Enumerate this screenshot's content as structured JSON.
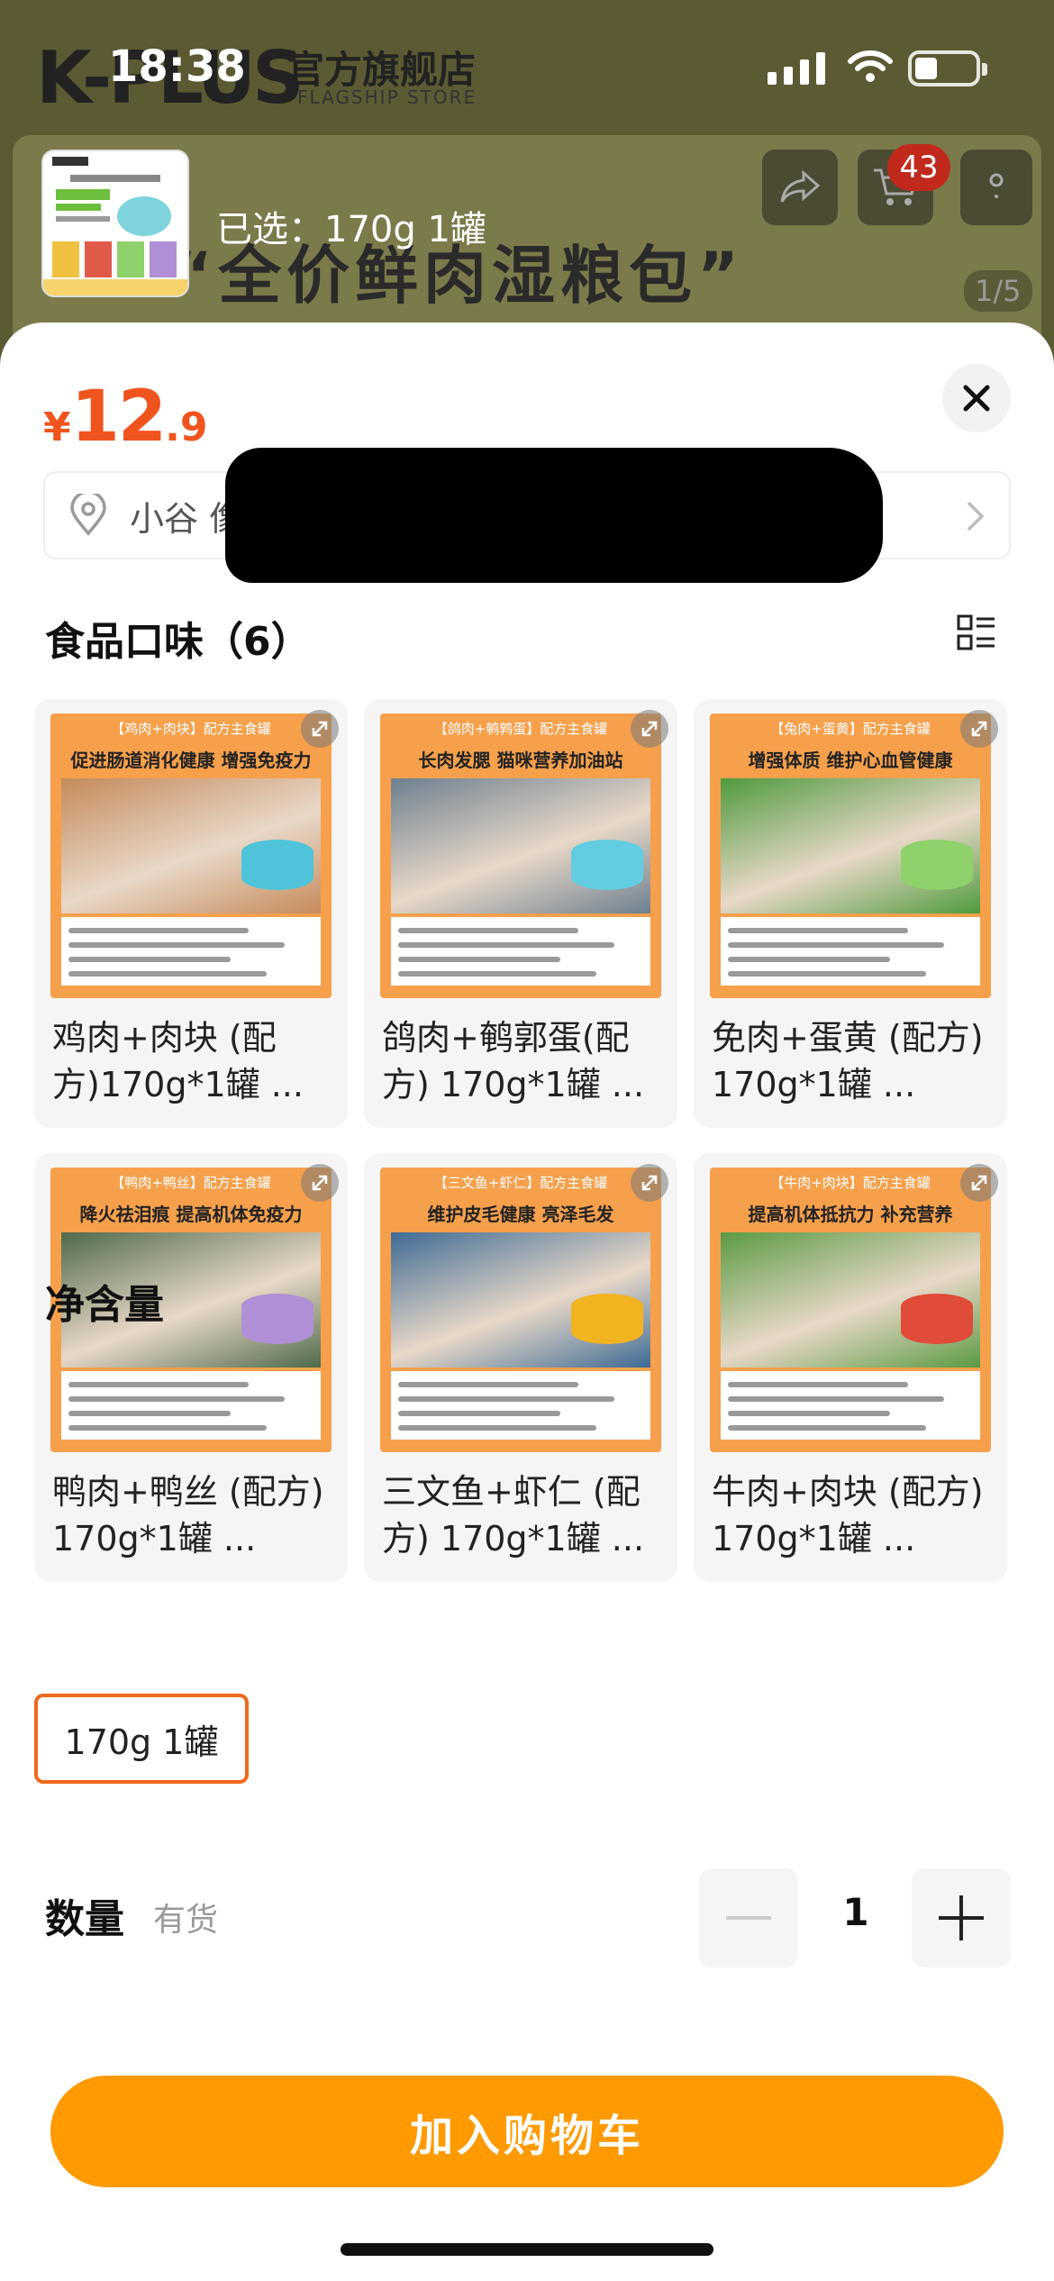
{
  "background": {
    "brand": "K-PLUS",
    "store_name": "官方旗舰店",
    "store_name_en": "FLAGSHIP STORE",
    "slogan": "“全价鲜肉湿粮包”",
    "cart_badge": "43",
    "pager": "1/5"
  },
  "status_bar": {
    "time": "18:38"
  },
  "selection": {
    "label": "已选：170g 1罐"
  },
  "price": {
    "symbol": "¥",
    "integer": "12",
    "decimal": ".9"
  },
  "address": {
    "text": "小谷 像"
  },
  "flavor_section": {
    "title": "食品口味（6）",
    "items": [
      {
        "name": "鸡肉+肉块 (配方)170g*1罐 ...",
        "img_tag": "【鸡肉+肉块】配方主食罐",
        "img_sub": "促进肠道消化健康 增强免疫力",
        "can_color": "#4fc3d9",
        "scene_color": "#c58a5a"
      },
      {
        "name": "鸽肉+鹌郭蛋(配方) 170g*1罐 ...",
        "img_tag": "【鸽肉+鹌鹑蛋】配方主食罐",
        "img_sub": "长肉发腮 猫咪营养加油站",
        "can_color": "#62cde0",
        "scene_color": "#6d7f8f"
      },
      {
        "name": "免肉+蛋黄 (配方) 170g*1罐 ...",
        "img_tag": "【兔肉+蛋黄】配方主食罐",
        "img_sub": "增强体质 维护心血管健康",
        "can_color": "#8fd16b",
        "scene_color": "#4f9a3d"
      },
      {
        "name": "鸭肉+鸭丝 (配方) 170g*1罐 ...",
        "img_tag": "【鸭肉+鸭丝】配方主食罐",
        "img_sub": "降火祛泪痕 提高机体免疫力",
        "can_color": "#b08fd6",
        "scene_color": "#4f6a4a"
      },
      {
        "name": "三文鱼+虾仁 (配方) 170g*1罐 ...",
        "img_tag": "【三文鱼+虾仁】配方主食罐",
        "img_sub": "维护皮毛健康 亮泽毛发",
        "can_color": "#f2b320",
        "scene_color": "#3f6b95"
      },
      {
        "name": "牛肉+肉块 (配方) 170g*1罐 ...",
        "img_tag": "【牛肉+肉块】配方主食罐",
        "img_sub": "提高机体抵抗力 补充营养",
        "can_color": "#e04b3a",
        "scene_color": "#5a9a42"
      }
    ]
  },
  "net_content": {
    "title": "净含量",
    "option": "170g 1罐"
  },
  "quantity": {
    "label": "数量",
    "stock": "有货",
    "value": "1"
  },
  "cart_button": {
    "label": "加入购物车"
  },
  "colors": {
    "accent": "#ff9a00",
    "price": "#f0541e",
    "selected_border": "#ef6a1c"
  }
}
